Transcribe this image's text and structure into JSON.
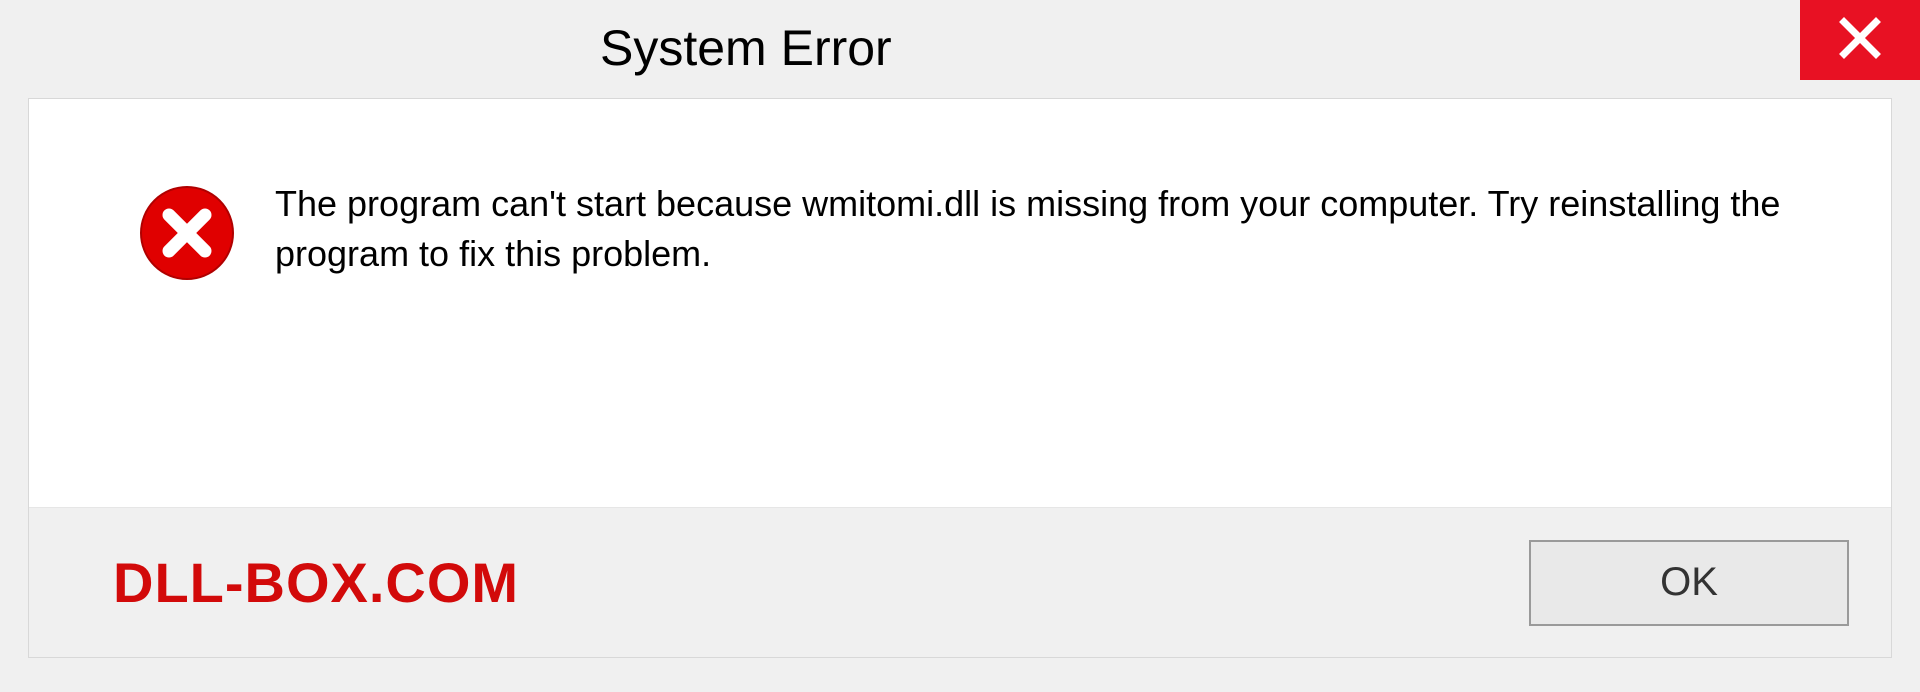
{
  "titlebar": {
    "title": "System Error"
  },
  "message": {
    "text": "The program can't start because wmitomi.dll is missing from your computer. Try reinstalling the program to fix this problem."
  },
  "footer": {
    "watermark": "DLL-BOX.COM",
    "ok_label": "OK"
  },
  "colors": {
    "close_bg": "#e81123",
    "error_icon": "#e00000",
    "watermark": "#d20a0a"
  }
}
